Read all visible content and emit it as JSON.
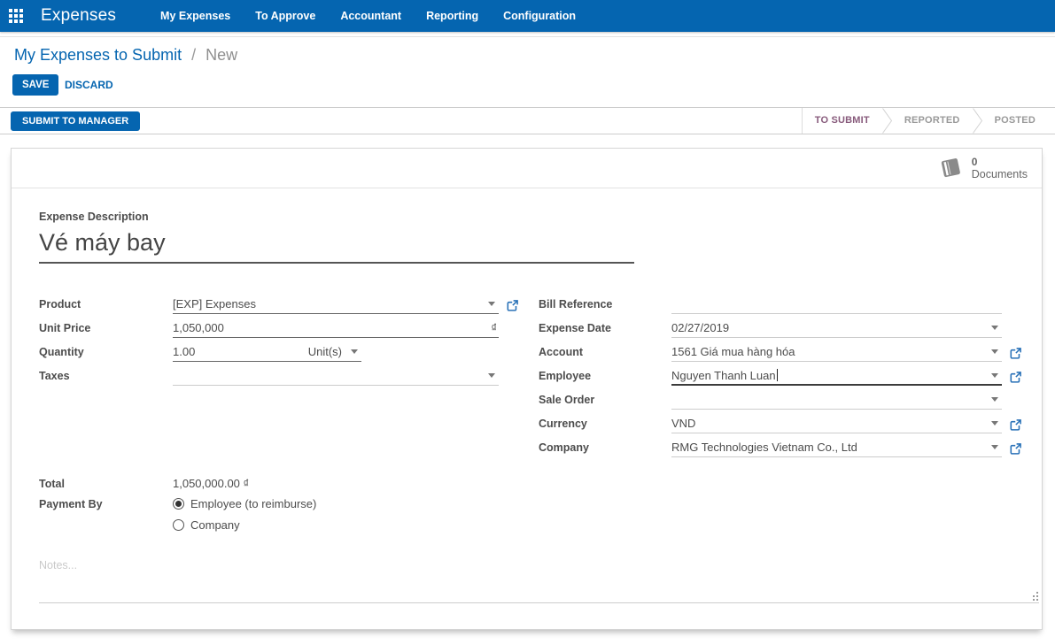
{
  "colors": {
    "accent": "#0565b0",
    "active_state": "#875a7b",
    "link_icon": "#2a72b8"
  },
  "nav": {
    "brand": "Expenses",
    "items": [
      "My Expenses",
      "To Approve",
      "Accountant",
      "Reporting",
      "Configuration"
    ]
  },
  "breadcrumb": {
    "parent": "My Expenses to Submit",
    "separator": "/",
    "current": "New"
  },
  "actions": {
    "save": "SAVE",
    "discard": "DISCARD"
  },
  "statusbar": {
    "submit_button": "SUBMIT TO MANAGER",
    "states": [
      "TO SUBMIT",
      "REPORTED",
      "POSTED"
    ],
    "active_state": "TO SUBMIT"
  },
  "stat_button": {
    "count": "0",
    "label": "Documents"
  },
  "form": {
    "description": {
      "label": "Expense Description",
      "value": "Vé máy bay"
    },
    "product": {
      "label": "Product",
      "value": "[EXP] Expenses"
    },
    "unit_price": {
      "label": "Unit Price",
      "value": "1,050,000",
      "currency_symbol": "₫"
    },
    "quantity": {
      "label": "Quantity",
      "value": "1.00",
      "uom": "Unit(s)"
    },
    "taxes": {
      "label": "Taxes",
      "value": ""
    },
    "bill_reference": {
      "label": "Bill Reference",
      "value": ""
    },
    "expense_date": {
      "label": "Expense Date",
      "value": "02/27/2019"
    },
    "account": {
      "label": "Account",
      "value": "1561 Giá mua hàng hóa"
    },
    "employee": {
      "label": "Employee",
      "value": "Nguyen Thanh Luan"
    },
    "sale_order": {
      "label": "Sale Order",
      "value": ""
    },
    "currency": {
      "label": "Currency",
      "value": "VND"
    },
    "company": {
      "label": "Company",
      "value": "RMG Technologies Vietnam Co., Ltd"
    },
    "total": {
      "label": "Total",
      "value": "1,050,000.00 ₫"
    },
    "payment_by": {
      "label": "Payment By",
      "options": [
        {
          "label": "Employee (to reimburse)",
          "selected": true
        },
        {
          "label": "Company",
          "selected": false
        }
      ]
    },
    "notes": {
      "placeholder": "Notes..."
    }
  }
}
